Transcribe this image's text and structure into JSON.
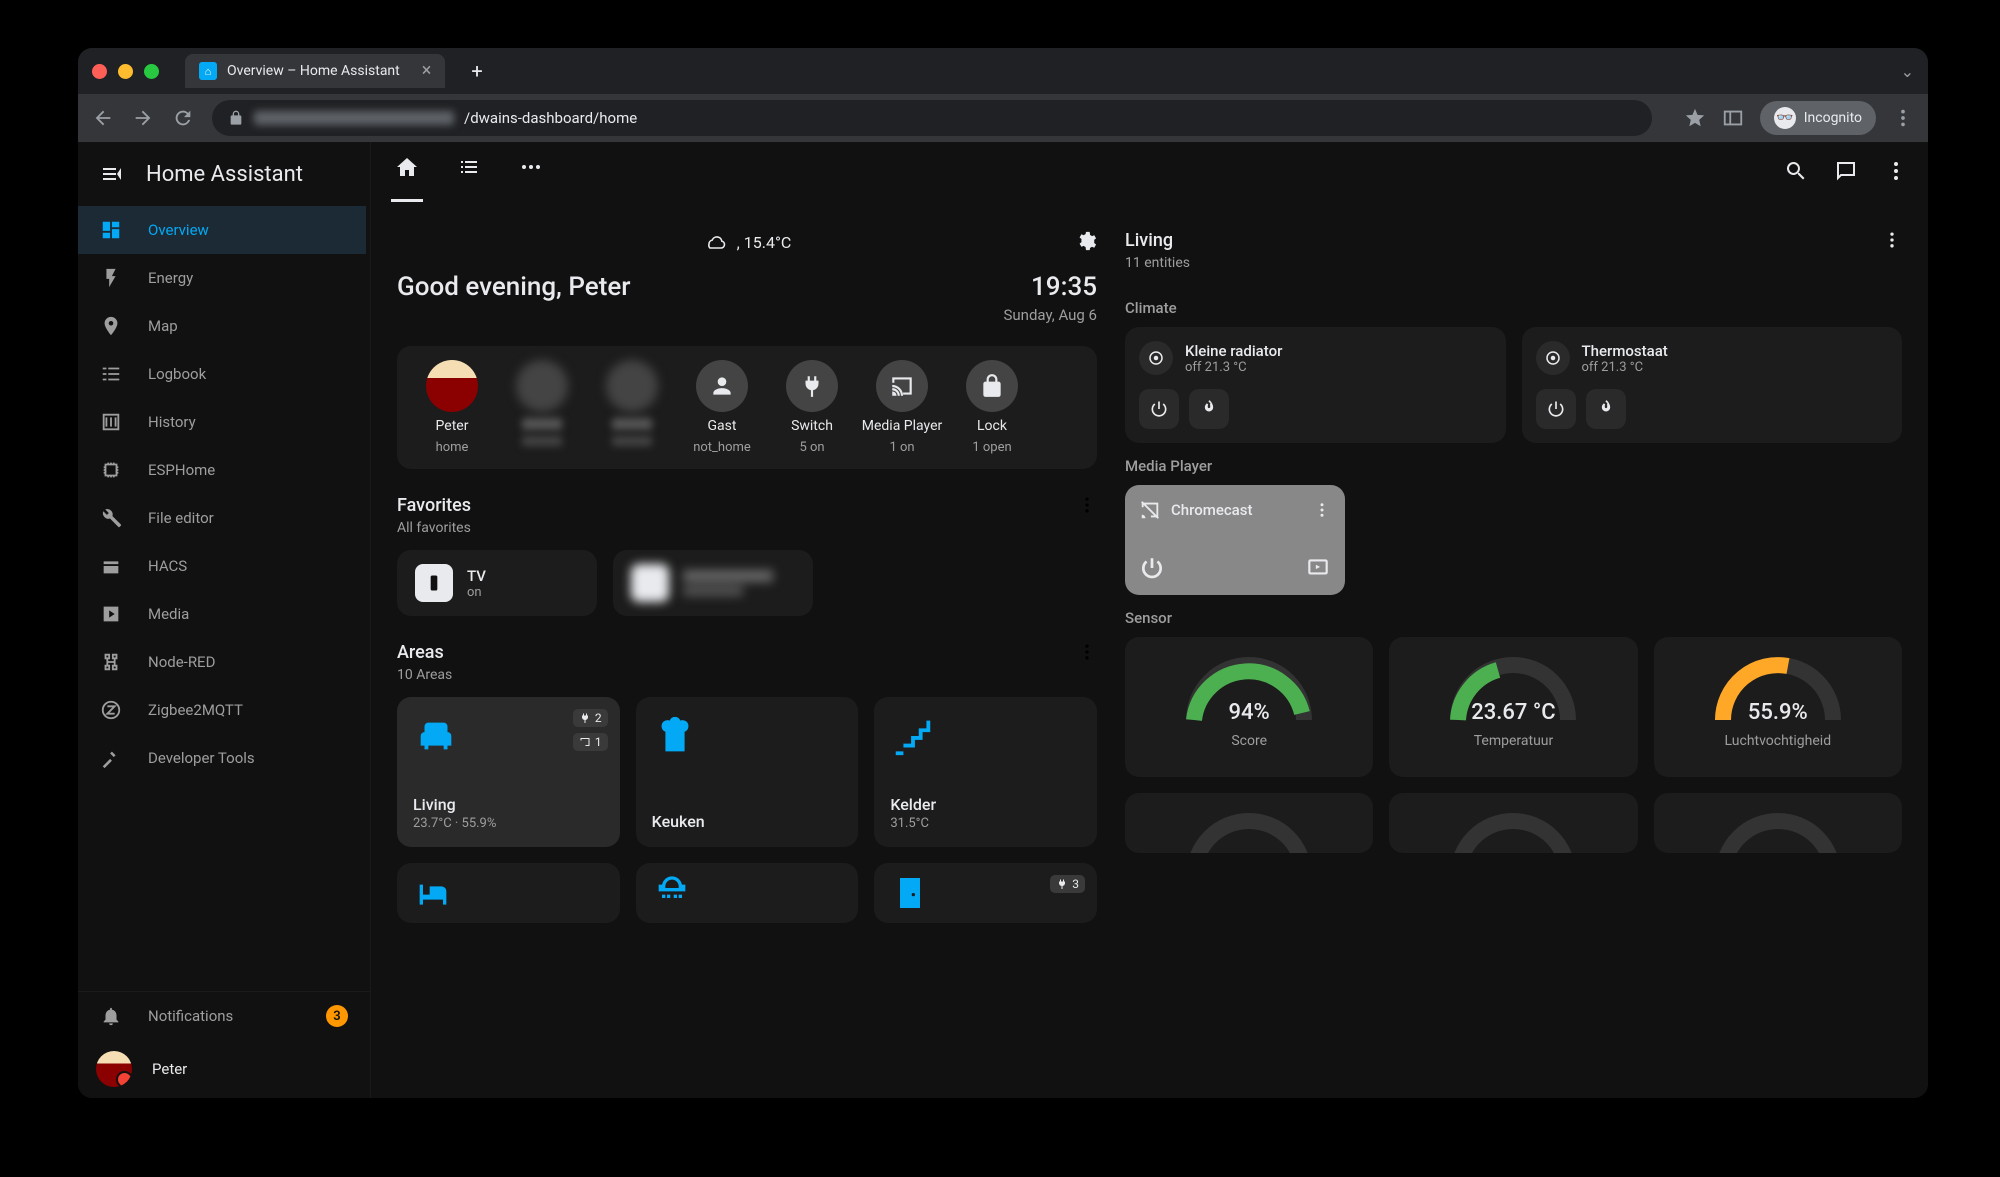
{
  "browser": {
    "tab_title": "Overview – Home Assistant",
    "url_path": "/dwains-dashboard/home",
    "incognito_label": "Incognito"
  },
  "sidebar": {
    "title": "Home Assistant",
    "items": [
      {
        "icon": "dashboard",
        "label": "Overview",
        "active": true
      },
      {
        "icon": "bolt",
        "label": "Energy"
      },
      {
        "icon": "map",
        "label": "Map"
      },
      {
        "icon": "logbook",
        "label": "Logbook"
      },
      {
        "icon": "history",
        "label": "History"
      },
      {
        "icon": "esp",
        "label": "ESPHome"
      },
      {
        "icon": "wrench",
        "label": "File editor"
      },
      {
        "icon": "hacs",
        "label": "HACS"
      },
      {
        "icon": "media",
        "label": "Media"
      },
      {
        "icon": "nodered",
        "label": "Node-RED"
      },
      {
        "icon": "zigbee",
        "label": "Zigbee2MQTT"
      },
      {
        "icon": "hammer",
        "label": "Developer Tools"
      }
    ],
    "notifications": {
      "label": "Notifications",
      "count": "3"
    },
    "user": "Peter"
  },
  "dashboard": {
    "weather_temp": ", 15.4°C",
    "greeting": "Good evening, Peter",
    "time": "19:35",
    "date": "Sunday, Aug 6",
    "status": [
      {
        "name": "Peter",
        "sub": "home",
        "type": "avatar"
      },
      {
        "name": "",
        "sub": "",
        "type": "blur"
      },
      {
        "name": "",
        "sub": "",
        "type": "blur"
      },
      {
        "name": "Gast",
        "sub": "not_home",
        "type": "person"
      },
      {
        "name": "Switch",
        "sub": "5 on",
        "type": "plug"
      },
      {
        "name": "Media Player",
        "sub": "1 on",
        "type": "cast"
      },
      {
        "name": "Lock",
        "sub": "1 open",
        "type": "lock"
      }
    ],
    "favorites": {
      "title": "Favorites",
      "sub": "All favorites",
      "items": [
        {
          "name": "TV",
          "sub": "on",
          "icon": "remote"
        },
        {
          "name": "",
          "sub": "",
          "blur": true
        }
      ]
    },
    "areas": {
      "title": "Areas",
      "sub": "10 Areas",
      "items": [
        {
          "name": "Living",
          "sub": "23.7°C · 55.9%",
          "icon": "sofa",
          "active": true,
          "badges": [
            {
              "icon": "plug",
              "n": "2"
            },
            {
              "icon": "cast",
              "n": "1"
            }
          ]
        },
        {
          "name": "Keuken",
          "sub": "",
          "icon": "chef"
        },
        {
          "name": "Kelder",
          "sub": "31.5°C",
          "icon": "stairs"
        },
        {
          "name": "",
          "sub": "",
          "icon": "bed"
        },
        {
          "name": "",
          "sub": "",
          "icon": "shower"
        },
        {
          "name": "",
          "sub": "",
          "icon": "door",
          "badges": [
            {
              "icon": "plug",
              "n": "3"
            }
          ]
        }
      ]
    }
  },
  "right": {
    "title": "Living",
    "sub": "11 entities",
    "climate_label": "Climate",
    "climate": [
      {
        "name": "Kleine radiator",
        "sub": "off 21.3 °C"
      },
      {
        "name": "Thermostaat",
        "sub": "off 21.3 °C"
      }
    ],
    "media_label": "Media Player",
    "media": {
      "name": "Chromecast"
    },
    "sensor_label": "Sensor",
    "sensors": [
      {
        "value": "94%",
        "label": "Score",
        "color": "#4caf50",
        "pct": 94
      },
      {
        "value": "23.67 °C",
        "label": "Temperatuur",
        "color": "#4caf50",
        "pct": 40
      },
      {
        "value": "55.9%",
        "label": "Luchtvochtigheid",
        "color": "#ffa726",
        "pct": 56
      }
    ]
  }
}
